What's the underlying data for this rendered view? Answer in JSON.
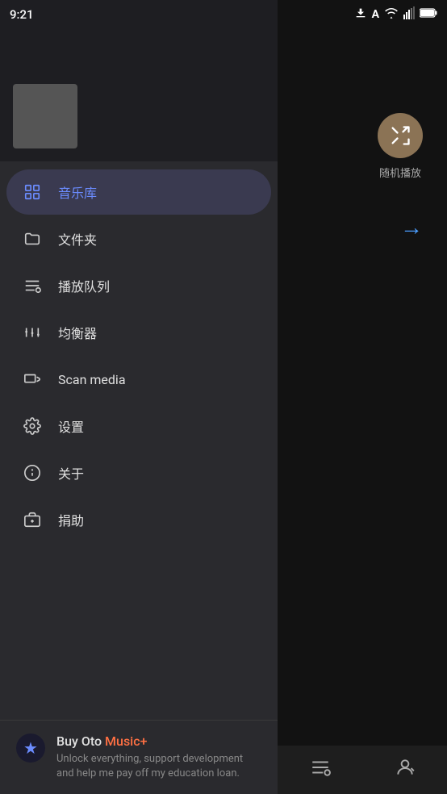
{
  "statusBar": {
    "time": "9:21",
    "downloadIcon": "⬇",
    "aIcon": "A"
  },
  "mainPanel": {
    "shuffleLabel": "随机播放",
    "arrowLabel": "→"
  },
  "bottomNav": {
    "queueIcon": "queue",
    "profileIcon": "person"
  },
  "drawer": {
    "navItems": [
      {
        "id": "library",
        "label": "音乐库",
        "icon": "library",
        "active": true
      },
      {
        "id": "folders",
        "label": "文件夹",
        "icon": "folder",
        "active": false
      },
      {
        "id": "queue",
        "label": "播放队列",
        "icon": "queue",
        "active": false
      },
      {
        "id": "equalizer",
        "label": "均衡器",
        "icon": "equalizer",
        "active": false
      },
      {
        "id": "scan",
        "label": "Scan media",
        "icon": "scan",
        "active": false
      },
      {
        "id": "settings",
        "label": "设置",
        "icon": "settings",
        "active": false
      },
      {
        "id": "about",
        "label": "关于",
        "icon": "info",
        "active": false
      },
      {
        "id": "donate",
        "label": "捐助",
        "icon": "donate",
        "active": false
      }
    ],
    "promo": {
      "titlePrefix": "Buy Oto ",
      "titleHighlight": "Music+",
      "description": "Unlock everything, support development and help me pay off my education loan."
    }
  }
}
